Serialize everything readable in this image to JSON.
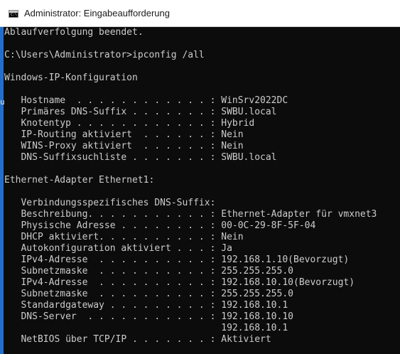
{
  "window": {
    "title": "Administrator: Eingabeaufforderung",
    "icon": "command-prompt-icon",
    "edge_char": "u"
  },
  "console": {
    "lines": [
      "Ablaufverfolgung beendet.",
      "",
      "C:\\Users\\Administrator>ipconfig /all",
      "",
      "Windows-IP-Konfiguration",
      "",
      "   Hostname  . . . . . . . . . . . . : WinSrv2022DC",
      "   Primäres DNS-Suffix . . . . . . . : SWBU.local",
      "   Knotentyp . . . . . . . . . . . . : Hybrid",
      "   IP-Routing aktiviert  . . . . . . : Nein",
      "   WINS-Proxy aktiviert  . . . . . . : Nein",
      "   DNS-Suffixsuchliste . . . . . . . : SWBU.local",
      "",
      "Ethernet-Adapter Ethernet1:",
      "",
      "   Verbindungsspezifisches DNS-Suffix:",
      "   Beschreibung. . . . . . . . . . . : Ethernet-Adapter für vmxnet3",
      "   Physische Adresse . . . . . . . . : 00-0C-29-8F-5F-04",
      "   DHCP aktiviert. . . . . . . . . . : Nein",
      "   Autokonfiguration aktiviert . . . : Ja",
      "   IPv4-Adresse  . . . . . . . . . . : 192.168.1.10(Bevorzugt)",
      "   Subnetzmaske  . . . . . . . . . . : 255.255.255.0",
      "   IPv4-Adresse  . . . . . . . . . . : 192.168.10.10(Bevorzugt)",
      "   Subnetzmaske  . . . . . . . . . . : 255.255.255.0",
      "   Standardgateway . . . . . . . . . : 192.168.10.1",
      "   DNS-Server  . . . . . . . . . . . : 192.168.10.10",
      "                                       192.168.10.1",
      "   NetBIOS über TCP/IP . . . . . . . : Aktiviert"
    ]
  },
  "colors": {
    "console_background": "#0c0c0c",
    "console_text": "#cccccc",
    "titlebar_background": "#ffffff",
    "desktop_accent": "#1f6fd0"
  }
}
